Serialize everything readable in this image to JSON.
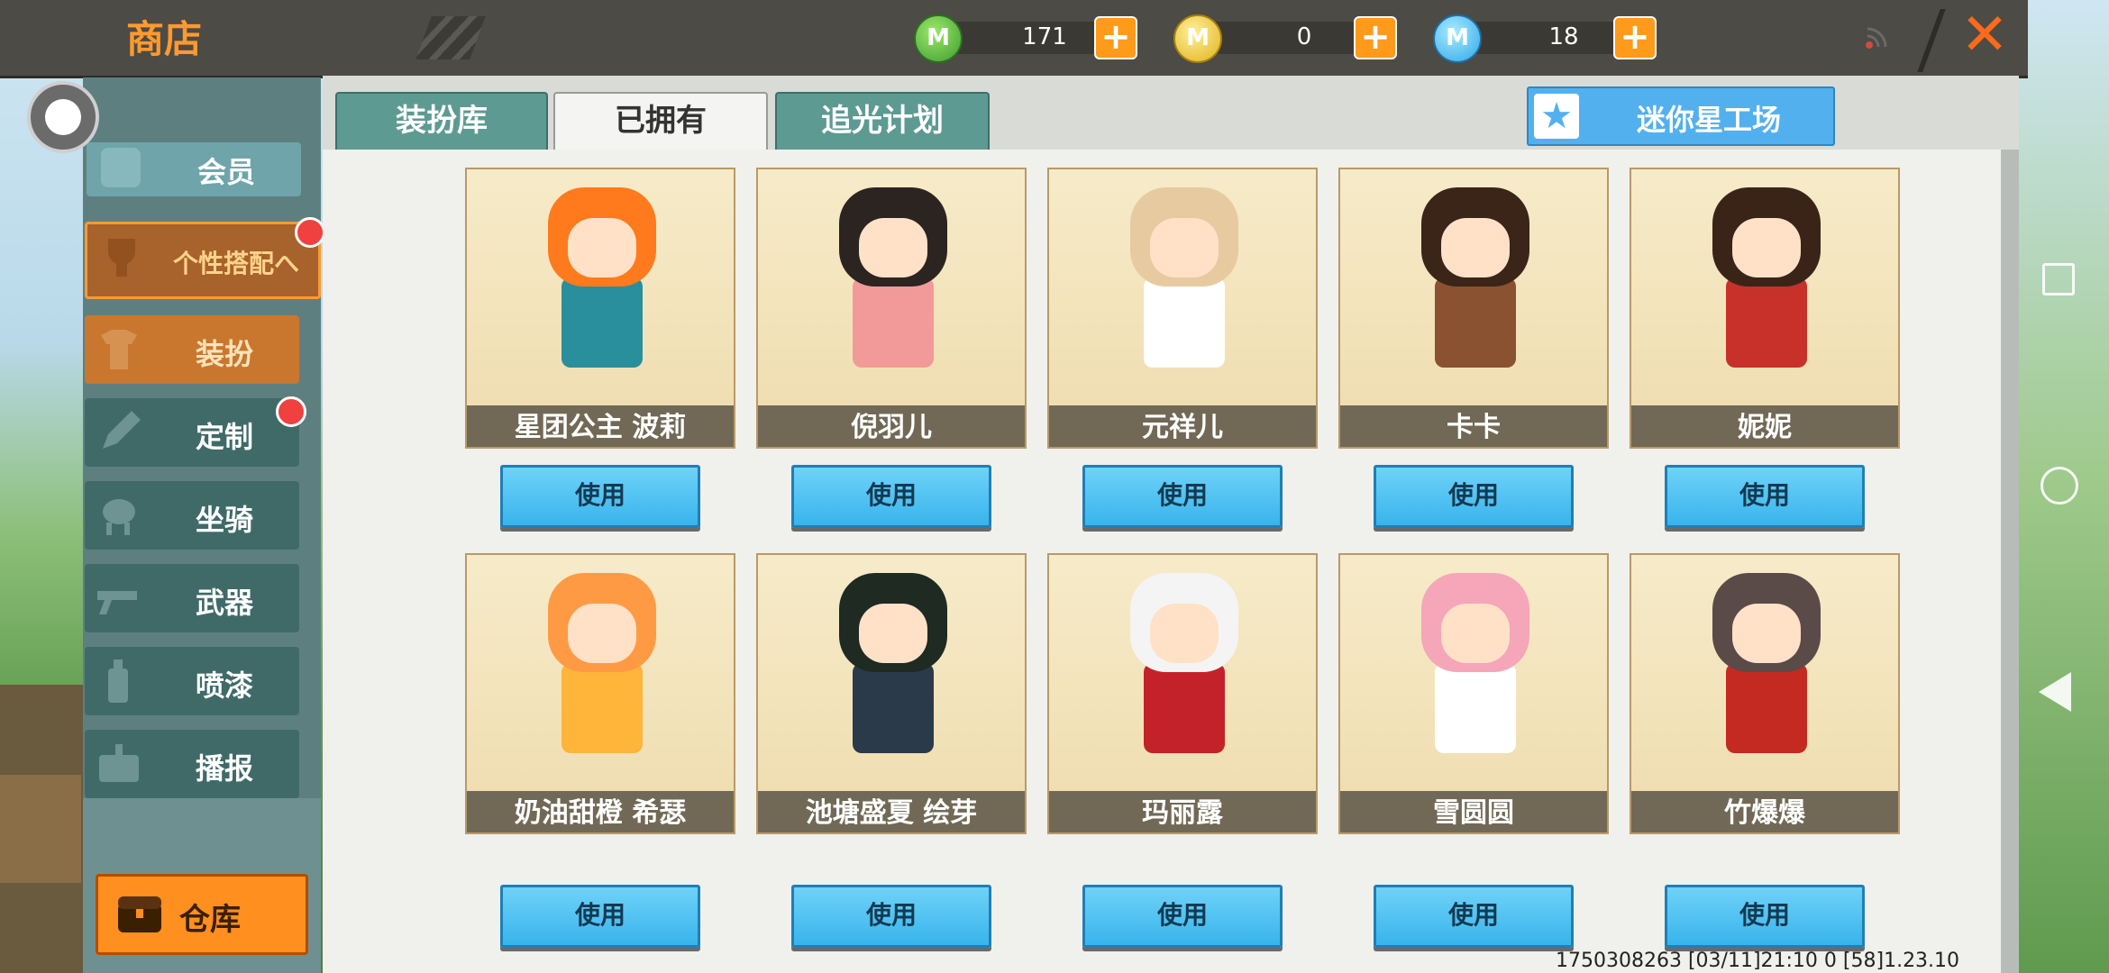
{
  "topbar": {
    "title": "商店",
    "currencies": [
      {
        "icon": "green-mini-coin-icon",
        "symbol": "M",
        "value": "171"
      },
      {
        "icon": "gold-mini-coin-icon",
        "symbol": "M",
        "value": "0"
      },
      {
        "icon": "blue-mini-coin-icon",
        "symbol": "M",
        "value": "18"
      }
    ],
    "plus_label": "+",
    "close_label": "✕"
  },
  "sidebar": {
    "member": "会员",
    "group": "个性搭配へ",
    "items": [
      {
        "label": "装扮",
        "icon": "outfit-icon",
        "active": true
      },
      {
        "label": "定制",
        "icon": "customize-icon",
        "badge": true
      },
      {
        "label": "坐骑",
        "icon": "mount-icon"
      },
      {
        "label": "武器",
        "icon": "weapon-icon"
      },
      {
        "label": "喷漆",
        "icon": "spray-icon"
      },
      {
        "label": "播报",
        "icon": "broadcast-icon"
      }
    ],
    "warehouse": "仓库"
  },
  "tabs": [
    {
      "label": "装扮库",
      "active": false
    },
    {
      "label": "已拥有",
      "active": true
    },
    {
      "label": "追光计划",
      "active": false
    }
  ],
  "star_workshop": "迷你星工场",
  "use_label": "使用",
  "skins": [
    {
      "name": "星团公主 波莉",
      "hair": "#ff7a1c",
      "outfit": "#2a8f9c"
    },
    {
      "name": "倪羽儿",
      "hair": "#2b2420",
      "outfit": "#f29a9a"
    },
    {
      "name": "元祥儿",
      "hair": "#e8caa0",
      "outfit": "#ffffff"
    },
    {
      "name": "卡卡",
      "hair": "#3b2418",
      "outfit": "#8a5230"
    },
    {
      "name": "妮妮",
      "hair": "#3a2418",
      "outfit": "#c8302a"
    },
    {
      "name": "奶油甜橙 希瑟",
      "hair": "#ff9a44",
      "outfit": "#ffb43a"
    },
    {
      "name": "池塘盛夏 绘芽",
      "hair": "#1e2a22",
      "outfit": "#2a3a4a"
    },
    {
      "name": "玛丽露",
      "hair": "#f4f4f4",
      "outfit": "#c4222a"
    },
    {
      "name": "雪圆圆",
      "hair": "#f5a6b8",
      "outfit": "#ffffff"
    },
    {
      "name": "竹爆爆",
      "hair": "#5a4a48",
      "outfit": "#c42a22"
    }
  ],
  "footer": "1750308263  [03/11]21:10 0    [58]1.23.10"
}
